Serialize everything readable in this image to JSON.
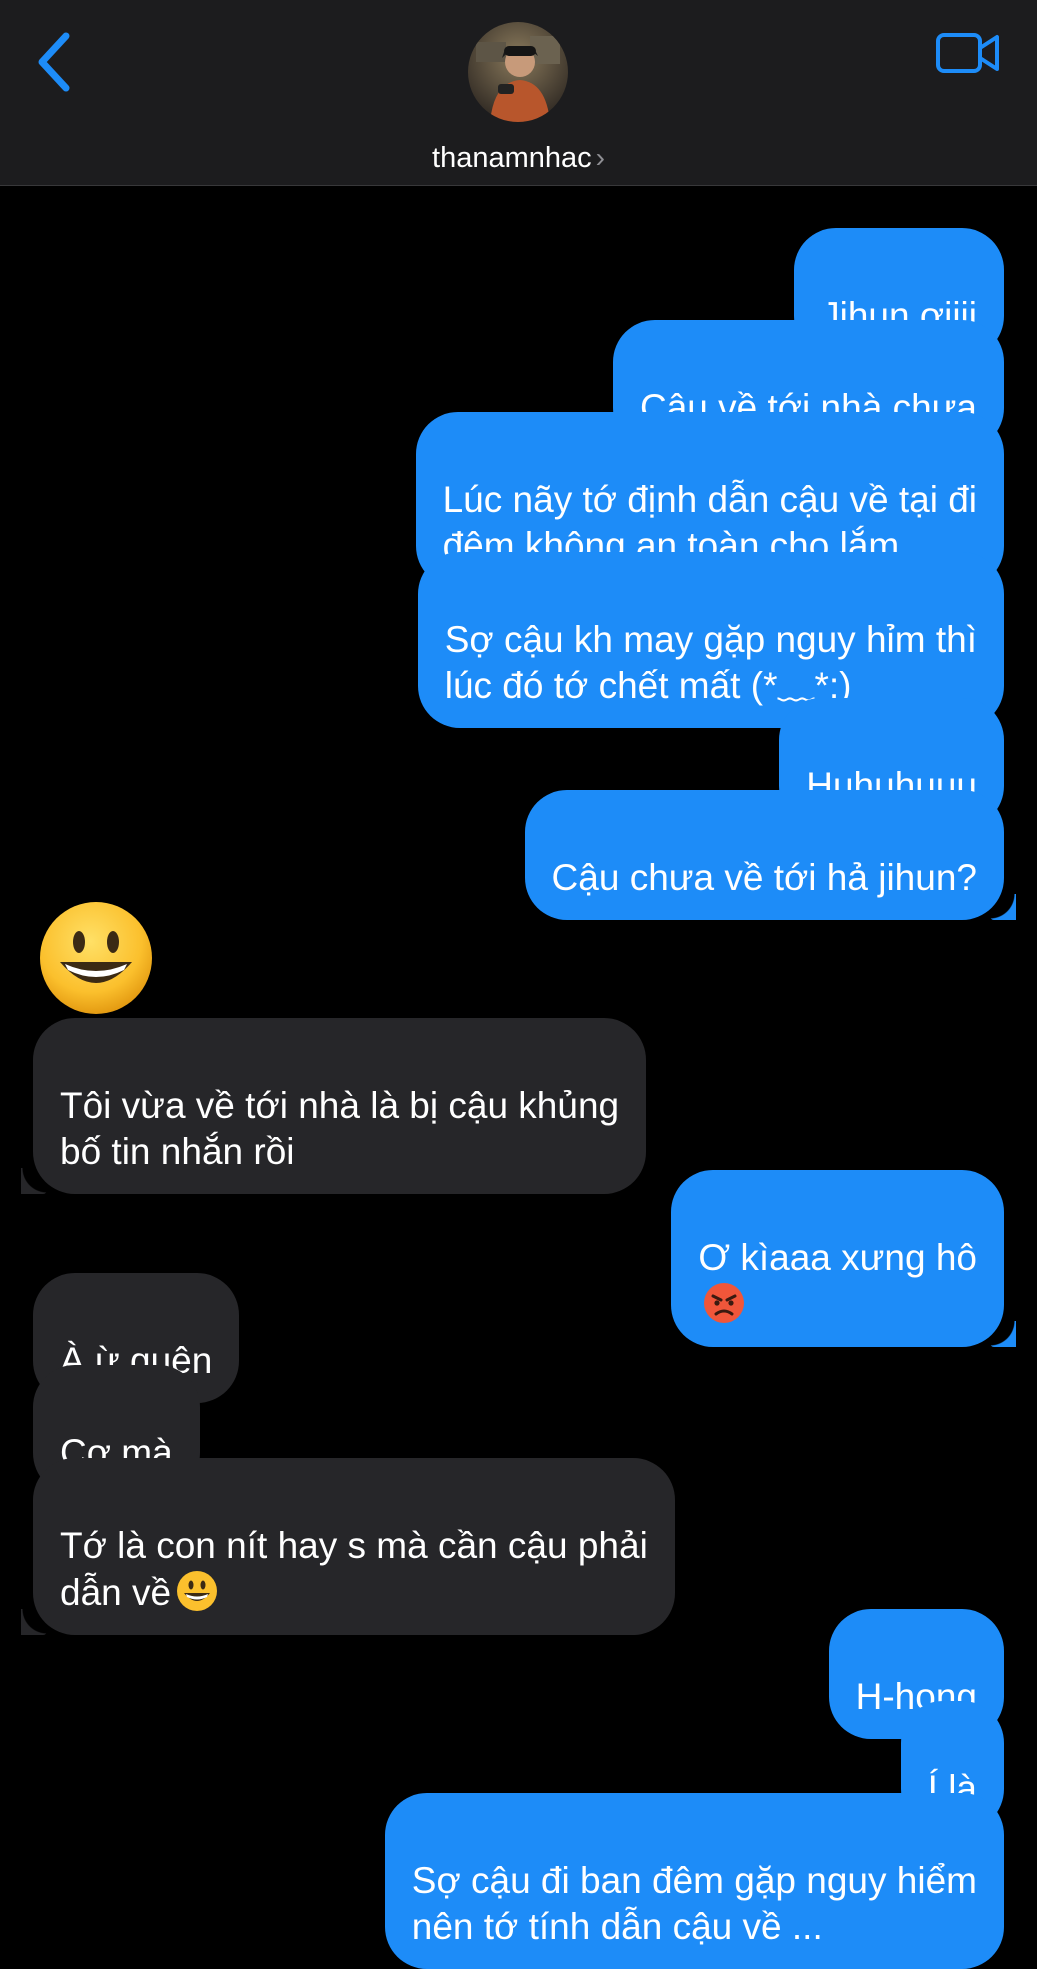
{
  "header": {
    "contact_name": "thanamnhac",
    "chevron": "›",
    "back_icon": "chevron-left-icon",
    "video_icon": "video-camera-icon",
    "accent_color": "#1d8cf8"
  },
  "messages": [
    {
      "from": "me",
      "text": "Jihun ơiiii"
    },
    {
      "from": "me",
      "text": "Cậu về tới nhà chưa"
    },
    {
      "from": "me",
      "text": "Lúc nãy tớ định dẫn cậu về tại đi\nđêm không an toàn cho lắm"
    },
    {
      "from": "me",
      "text": "Sợ cậu kh may gặp nguy hỉm thì\nlúc đó tớ chết mất (*﹏*;)"
    },
    {
      "from": "me",
      "text": "Huhuhuuu"
    },
    {
      "from": "me",
      "text": "Cậu chưa về tới hả jihun?"
    },
    {
      "from": "them",
      "emoji": "smiling-face-emoji"
    },
    {
      "from": "them",
      "text": "Tôi vừa về tới nhà là bị cậu khủng\nbố tin nhắn rồi"
    },
    {
      "from": "me",
      "text": "Ơ kìaaa xưng hô",
      "emoji": "angry-face-emoji"
    },
    {
      "from": "them",
      "text": "À ừ quên"
    },
    {
      "from": "them",
      "text": "Cơ mà"
    },
    {
      "from": "them",
      "text": "Tớ là con nít hay s mà cần cậu phải\ndẫn về",
      "emoji": "smiling-face-emoji"
    },
    {
      "from": "me",
      "text": "H-hong"
    },
    {
      "from": "me",
      "text": "Í là"
    },
    {
      "from": "me",
      "text": "Sợ cậu đi ban đêm gặp nguy hiểm\nnên tớ tính dẫn cậu về ..."
    }
  ]
}
